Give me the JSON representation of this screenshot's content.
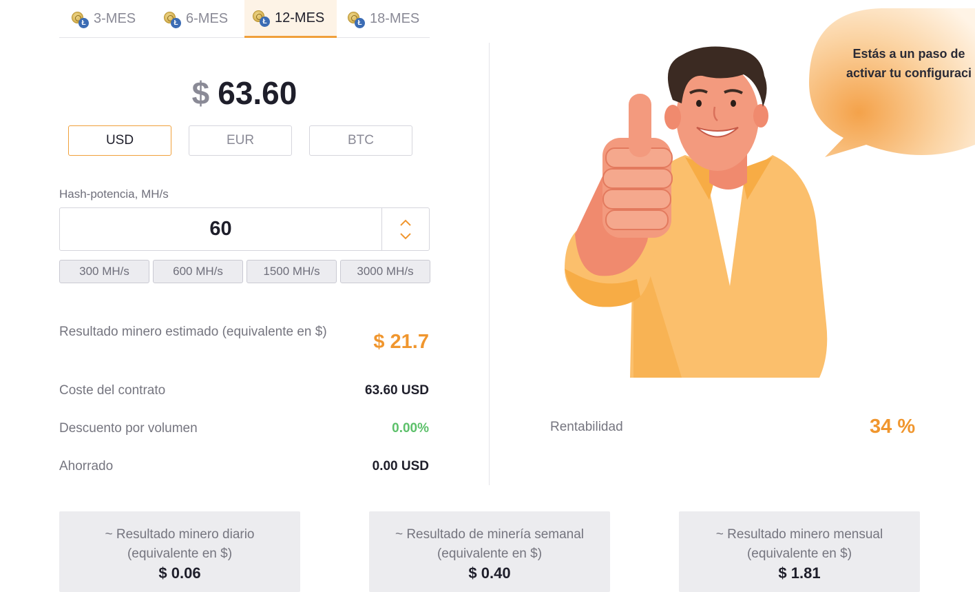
{
  "tabs": [
    {
      "label": "3-MES"
    },
    {
      "label": "6-MES"
    },
    {
      "label": "12-MES"
    },
    {
      "label": "18-MES"
    }
  ],
  "price": {
    "symbol": "$",
    "amount": "63.60"
  },
  "currencies": [
    "USD",
    "EUR",
    "BTC"
  ],
  "selected_currency": "USD",
  "hash": {
    "label": "Hash-potencia, MH/s",
    "value": "60"
  },
  "presets": [
    "300 MH/s",
    "600 MH/s",
    "1500 MH/s",
    "3000 MH/s"
  ],
  "stats": {
    "estimated_label": "Resultado minero estimado (equivalente en $)",
    "estimated_value": "$ 21.7",
    "cost_label": "Coste del contrato",
    "cost_value": "63.60 USD",
    "discount_label": "Descuento por volumen",
    "discount_value": "0.00%",
    "saved_label": "Ahorrado",
    "saved_value": "0.00 USD"
  },
  "rentability": {
    "label": "Rentabilidad",
    "value": "34 %"
  },
  "bubble": {
    "line1": "Estás a un paso de",
    "line2": "activar tu configuraci"
  },
  "cards": [
    {
      "label": "~ Resultado minero diario (equivalente en $)",
      "value": "$ 0.06"
    },
    {
      "label": "~ Resultado de minería semanal (equivalente en $)",
      "value": "$ 0.40"
    },
    {
      "label": "~ Resultado minero mensual (equivalente en $)",
      "value": "$ 1.81"
    }
  ],
  "colors": {
    "accent": "#f0962e",
    "positive": "#5cc06a",
    "muted": "#75757f"
  }
}
